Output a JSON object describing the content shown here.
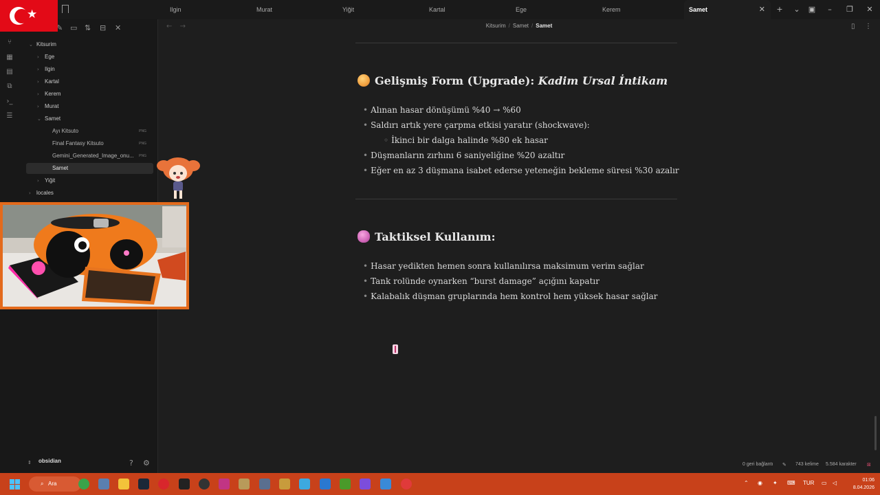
{
  "tabs": [
    "Ilgin",
    "Murat",
    "Yiğit",
    "Kartal",
    "Ege",
    "Kerem",
    "Samet"
  ],
  "active_tab": "Samet",
  "breadcrumb": {
    "root": "Kitsurim",
    "folder": "Samet",
    "current": "Samet"
  },
  "sidebar": {
    "root": "Kitsurim",
    "folders": [
      "Ege",
      "Ilgin",
      "Kartal",
      "Kerem",
      "Murat",
      "Samet"
    ],
    "samet_files": [
      {
        "name": "Ayı Kitsuto",
        "ext": "PNG"
      },
      {
        "name": "Final Fantasy Kitsuto",
        "ext": "PNG"
      },
      {
        "name": "Gemini_Generated_Image_onu...",
        "ext": "PNG"
      }
    ],
    "selected_note": "Samet",
    "after": [
      "Yiğit"
    ],
    "locales": "locales",
    "vault_name": "obsidian"
  },
  "document": {
    "section1": {
      "title_plain": "Gelişmiş Form (Upgrade): ",
      "title_italic": "Kadim Ursal İntikam",
      "items": [
        "Alınan hasar dönüşümü %40 → %60",
        "Saldırı artık yere çarpma etkisi yaratır (shockwave):",
        "İkinci bir dalga halinde %80 ek hasar",
        "Düşmanların zırhını 6 saniyeliğine %20 azaltır",
        "Eğer en az 3 düşmana isabet ederse yeteneğin bekleme süresi %30 azalır"
      ]
    },
    "section2": {
      "title": "Taktiksel Kullanım:",
      "items": [
        "Hasar yedikten hemen sonra kullanılırsa maksimum verim sağlar",
        "Tank rolünde oynarken “burst damage” açığını kapatır",
        "Kalabalık düşman gruplarında hem kontrol hem yüksek hasar sağlar"
      ]
    }
  },
  "status": {
    "backlinks": "0 geri bağlantı",
    "words": "743 kelime",
    "chars": "5.584 karakter"
  },
  "taskbar": {
    "search": "Ara",
    "lang": "TUR",
    "time": "01:06",
    "date": "8.04.2026"
  },
  "colors": {
    "accent": "#c8411a",
    "section1_emoji": "#f0a040",
    "section2_emoji": "#d066b8"
  }
}
